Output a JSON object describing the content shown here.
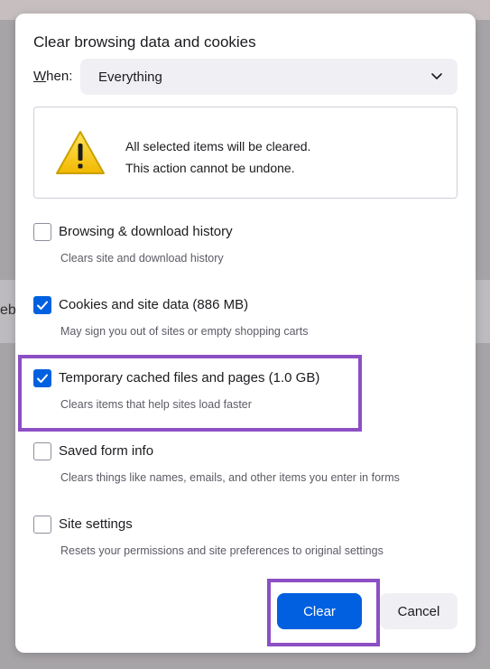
{
  "background": {
    "partial_text": "eb"
  },
  "dialog": {
    "title": "Clear browsing data and cookies",
    "when": {
      "label_first": "W",
      "label_rest": "hen:",
      "selected": "Everything"
    },
    "warning": {
      "line1": "All selected items will be cleared.",
      "line2": "This action cannot be undone."
    },
    "items": [
      {
        "label": "Browsing & download history",
        "description": "Clears site and download history",
        "checked": false
      },
      {
        "label": "Cookies and site data (886 MB)",
        "description": "May sign you out of sites or empty shopping carts",
        "checked": true
      },
      {
        "label": "Temporary cached files and pages (1.0 GB)",
        "description": "Clears items that help sites load faster",
        "checked": true
      },
      {
        "label": "Saved form info",
        "description": "Clears things like names, emails, and other items you enter in forms",
        "checked": false
      },
      {
        "label": "Site settings",
        "description": "Resets your permissions and site preferences to original settings",
        "checked": false
      }
    ],
    "buttons": {
      "clear": "Clear",
      "cancel": "Cancel"
    }
  },
  "colors": {
    "accent": "#0060df",
    "highlight": "#8c4fc4",
    "warning_yellow": "#f5c400"
  },
  "icons": [
    "chevron-down-icon",
    "warning-icon",
    "checkmark-icon"
  ]
}
